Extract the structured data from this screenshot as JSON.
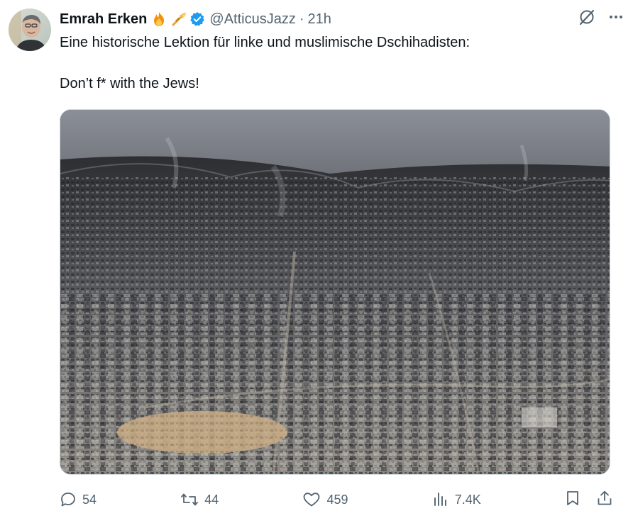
{
  "author": {
    "display_name": "Emrah Erken",
    "badges": [
      "fire-emoji",
      "trumpet-emoji"
    ],
    "verified": true,
    "handle": "@AtticusJazz",
    "separator": "·",
    "time": "21h"
  },
  "tweet": {
    "line1": "Eine historische Lektion für linke und muslimische Dschihadisten:",
    "line2": "Don’t f* with the Jews!"
  },
  "media": {
    "kind": "aerial-photo-of-dense-city"
  },
  "stats": {
    "replies": "54",
    "reposts": "44",
    "likes": "459",
    "views": "7.4K"
  },
  "colors": {
    "text_primary": "#0f1419",
    "text_secondary": "#536471",
    "verified_blue": "#1d9bf0",
    "border": "#cfd9de"
  }
}
